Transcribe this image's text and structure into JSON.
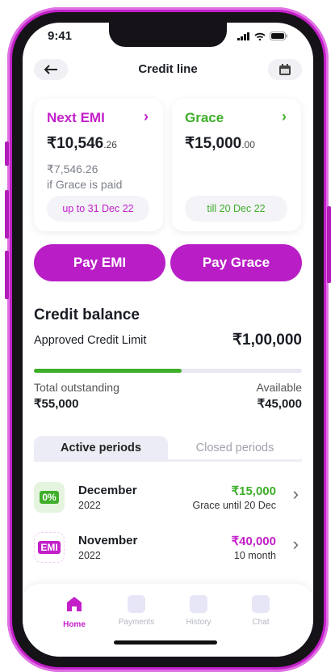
{
  "status_bar": {
    "time": "9:41"
  },
  "header": {
    "title": "Credit line",
    "back_icon": "arrow-left-icon",
    "calendar_icon": "calendar-icon"
  },
  "cards": [
    {
      "title": "Next EMI",
      "amount_main": "₹10,546",
      "amount_decimal": ".26",
      "sub_amount": "₹7,546.26",
      "sub_text": "if Grace is paid",
      "due": "up to 31 Dec 22",
      "color": "#c21fc9"
    },
    {
      "title": "Grace",
      "amount_main": "₹15,000",
      "amount_decimal": ".00",
      "due": "till 20 Dec 22",
      "color": "#3fae2a"
    }
  ],
  "actions": {
    "pay_emi": "Pay EMI",
    "pay_grace": "Pay Grace"
  },
  "balance": {
    "heading": "Credit balance",
    "limit_label": "Approved Credit Limit",
    "limit_value": "₹1,00,000",
    "outstanding_label": "Total outstanding",
    "outstanding_value": "₹55,000",
    "available_label": "Available",
    "available_value": "₹45,000",
    "used_fraction": 0.55
  },
  "tabs": {
    "active": "Active periods",
    "closed": "Closed periods"
  },
  "periods": [
    {
      "badge": "0%",
      "month": "December",
      "year": "2022",
      "amount": "₹15,000",
      "note": "Grace until 20 Dec"
    },
    {
      "badge": "EMI",
      "month": "November",
      "year": "2022",
      "amount": "₹40,000",
      "note": "10 month"
    }
  ],
  "nav": [
    {
      "label": "Home"
    },
    {
      "label": "Payments"
    },
    {
      "label": "History"
    },
    {
      "label": "Chat"
    }
  ]
}
